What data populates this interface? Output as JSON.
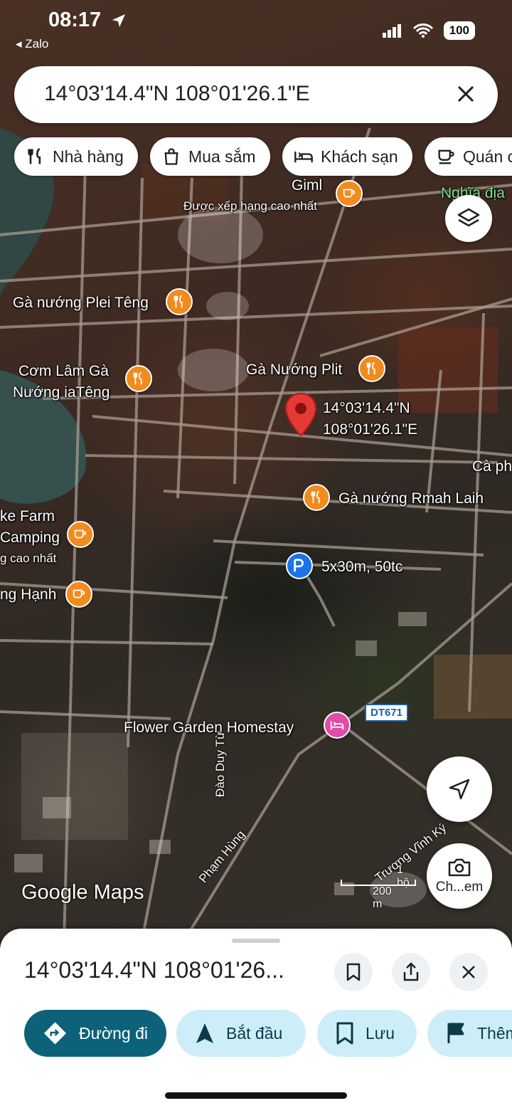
{
  "status_bar": {
    "time": "08:17",
    "back_app": "Zalo",
    "battery": "100"
  },
  "search": {
    "query": "14°03'14.4\"N 108°01'26.1\"E"
  },
  "chips": [
    {
      "label": "Nhà hàng",
      "icon": "fork-knife-icon"
    },
    {
      "label": "Mua sắm",
      "icon": "shopping-bag-icon"
    },
    {
      "label": "Khách sạn",
      "icon": "bed-icon"
    },
    {
      "label": "Quán c",
      "icon": "coffee-icon"
    }
  ],
  "map": {
    "labels": {
      "giml": "Giml",
      "giml_sub": "Được xếp hạng cao nhất",
      "nghia_dia": "Nghĩa địa",
      "plei_teng": "Gà nướng Plei Têng",
      "com_lam_1": "Cơm Lâm Gà",
      "com_lam_2": "Nướng iaTêng",
      "plit": "Gà Nướng Plit",
      "pin_lat": "14°03'14.4\"N",
      "pin_lng": "108°01'26.1\"E",
      "ca_ph": "Cà ph",
      "rmah_laih": "Gà nướng Rmah Laih",
      "lake_farm": "ke Farm",
      "camping": "Camping",
      "camping_sub": "g cao nhất",
      "hanh": "ng Hạnh",
      "parking": "5x30m, 50tc",
      "flower_garden": "Flower Garden Homestay",
      "route": "DT671",
      "road_dao_duy_tu": "Đào Duy Từ",
      "road_pham_hung": "Phạm Hùng",
      "road_truong_vinh_ky": "Trương Vĩnh Ký",
      "scale_ft": "1 bộ",
      "scale_m": "200 m",
      "watermark": "Google Maps",
      "lens_label": "Ch...em"
    },
    "colors": {
      "restaurant": "#f28b1e",
      "cafe": "#f28b1e",
      "hotel": "#e04ca8",
      "parking": "#1a73e8",
      "pin": "#e53935"
    }
  },
  "sheet": {
    "title": "14°03'14.4\"N 108°01'26...",
    "actions": [
      {
        "label": "Đường đi",
        "icon": "directions-icon"
      },
      {
        "label": "Bắt đầu",
        "icon": "navigation-arrow-icon"
      },
      {
        "label": "Lưu",
        "icon": "bookmark-icon"
      },
      {
        "label": "Thêm",
        "icon": "flag-icon"
      }
    ]
  }
}
